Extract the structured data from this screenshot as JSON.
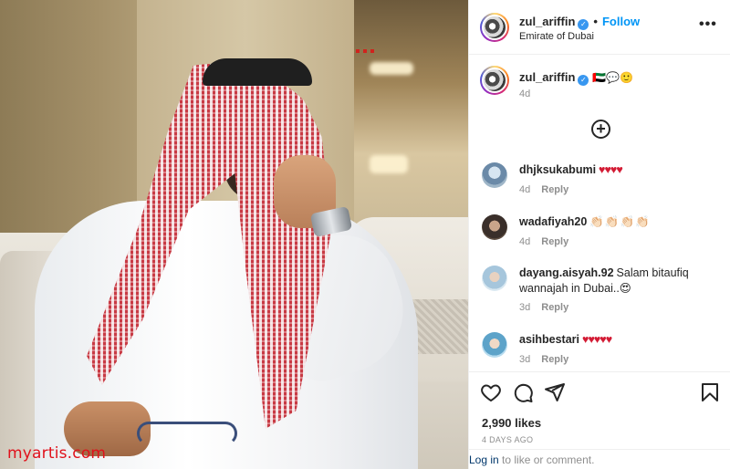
{
  "post": {
    "username": "zul_ariffin",
    "follow_label": "Follow",
    "separator": "•",
    "location": "Emirate of Dubai",
    "more_label": "•••"
  },
  "caption": {
    "username": "zul_ariffin",
    "text": "🇦🇪💬🙂",
    "time": "4d"
  },
  "load_more": "+",
  "comments": [
    {
      "username": "dhjksukabumi",
      "text": "♥♥♥♥",
      "time": "4d",
      "reply": "Reply"
    },
    {
      "username": "wadafiyah20",
      "text": "👏🏻👏🏻👏🏻👏🏻",
      "time": "4d",
      "reply": "Reply"
    },
    {
      "username": "dayang.aisyah.92",
      "text": "Salam bitaufiq wannajah in Dubai..😍",
      "time": "3d",
      "reply": "Reply"
    },
    {
      "username": "asihbestari",
      "text": "♥♥♥♥♥",
      "time": "3d",
      "reply": "Reply"
    }
  ],
  "likes": "2,990 likes",
  "date": "4 DAYS AGO",
  "login": {
    "link": "Log in",
    "rest": " to like or comment."
  },
  "watermark": "myartis.com",
  "colors": {
    "follow": "#0095f6",
    "verified": "#3897f0",
    "watermark": "#e0111b"
  }
}
